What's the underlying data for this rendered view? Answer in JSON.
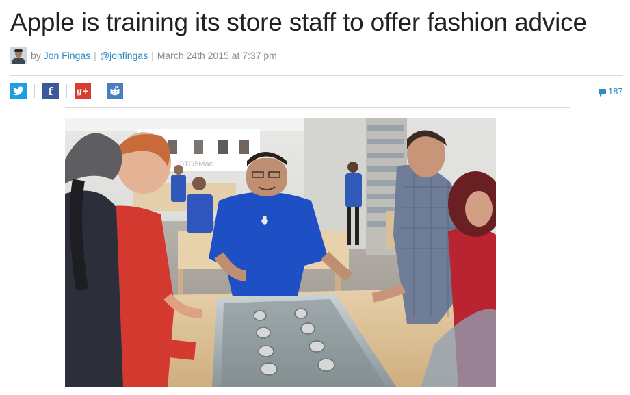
{
  "article": {
    "title": "Apple is training its store staff to offer fashion advice",
    "byline": {
      "by": "by",
      "author": "Jon Fingas",
      "handle": "@jonfingas",
      "date": "March 24th 2015 at 7:37 pm"
    },
    "share": {
      "twitter_icon": "twitter-icon",
      "facebook_icon": "facebook-icon",
      "googleplus_icon": "google-plus-icon",
      "reddit_icon": "reddit-icon",
      "twitter_glyph": "🐦",
      "facebook_glyph": "f",
      "googleplus_glyph": "g+"
    },
    "comment_count": "187",
    "hero": {
      "watermark": "9TO5Mac"
    }
  },
  "colors": {
    "link": "#2e89c7",
    "twitter": "#1d9de2",
    "facebook": "#3b5998",
    "googleplus": "#d73d32",
    "reddit": "#4a7fbf"
  }
}
